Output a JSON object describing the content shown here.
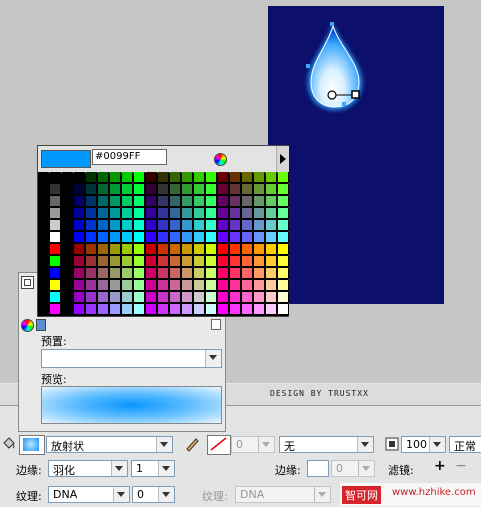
{
  "canvas": {
    "background": "#0c0f6b",
    "credit": "DESIGN BY TRUSTXX"
  },
  "swatch_popup": {
    "current_color": "#0099FF",
    "hex_value": "#0099FF",
    "icons": [
      "color-wheel-icon",
      "panel-menu-arrow-icon"
    ]
  },
  "mixer": {
    "preset_label": "预置:",
    "preset_value": "",
    "preview_label": "预览:",
    "preview_gradient": [
      "#e8f6ff",
      "#0a96ff"
    ]
  },
  "property_bar": {
    "fill_type": "放射状",
    "stroke_size": "0",
    "stroke_style": "无",
    "alpha": "100",
    "blend": "正常",
    "edge_label": "边缘:",
    "edge_type": "羽化",
    "edge_value": "1",
    "texture_label": "纹理:",
    "texture_value": "DNA",
    "texture_amount": "0",
    "edge2_label": "边缘:",
    "edge2_value": "0",
    "texture2_label": "纹理:",
    "texture2_value": "DNA",
    "filter_label": "滤镜:"
  },
  "watermark": {
    "site": "智可网",
    "url": "www.hzhike.com"
  }
}
